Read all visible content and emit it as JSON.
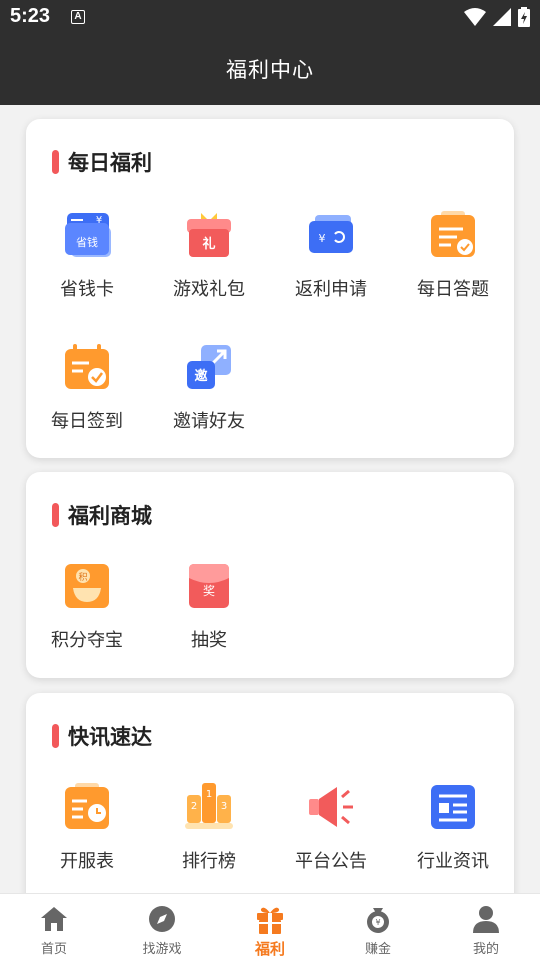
{
  "status": {
    "time": "5:23",
    "a_badge": "A"
  },
  "header": {
    "title": "福利中心"
  },
  "sections": {
    "daily": {
      "title": "每日福利",
      "items": [
        "省钱卡",
        "游戏礼包",
        "返利申请",
        "每日答题",
        "每日签到",
        "邀请好友"
      ]
    },
    "mall": {
      "title": "福利商城",
      "items": [
        "积分夺宝",
        "抽奖"
      ]
    },
    "news": {
      "title": "快讯速达",
      "items": [
        "开服表",
        "排行榜",
        "平台公告",
        "行业资讯"
      ]
    }
  },
  "icon_glyphs": {
    "savings_card": "省钱",
    "savings_card_currency": "¥",
    "gift_pack": "礼",
    "rebate": "¥",
    "invite": "邀",
    "points": "积",
    "lottery": "奖",
    "rank_numbers": [
      "2",
      "1",
      "3"
    ]
  },
  "tabs": [
    {
      "label": "首页",
      "active": false
    },
    {
      "label": "找游戏",
      "active": false
    },
    {
      "label": "福利",
      "active": true
    },
    {
      "label": "赚金",
      "active": false
    },
    {
      "label": "我的",
      "active": false
    }
  ],
  "colors": {
    "accent": "#f57a1f",
    "title_bar": "#f2585a",
    "header_bg": "#2f2f2f",
    "tab_inactive": "#666666"
  }
}
